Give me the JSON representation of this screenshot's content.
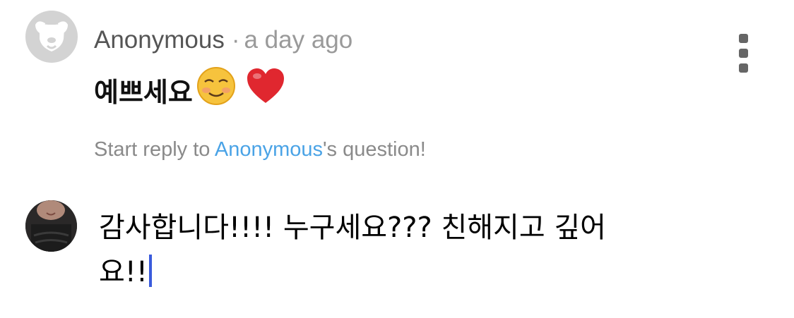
{
  "question": {
    "author": "Anonymous",
    "separator": "·",
    "timestamp": "a day ago",
    "text": "예쁘세요",
    "emojis": [
      "smiling-face-icon",
      "red-heart-icon"
    ],
    "more_icon": "vertical-ellipsis-icon"
  },
  "reply_prompt": {
    "prefix": "Start reply to ",
    "mention": "Anonymous",
    "suffix": "'s question!"
  },
  "reply": {
    "text_line1": "감사합니다!!!! 누구세요??? 친해지고 깊어",
    "text_line2": "요!!"
  },
  "colors": {
    "link": "#4aa3e6",
    "muted": "#9a9a9a",
    "caret": "#3a5bdc",
    "heart": "#e0272f"
  }
}
